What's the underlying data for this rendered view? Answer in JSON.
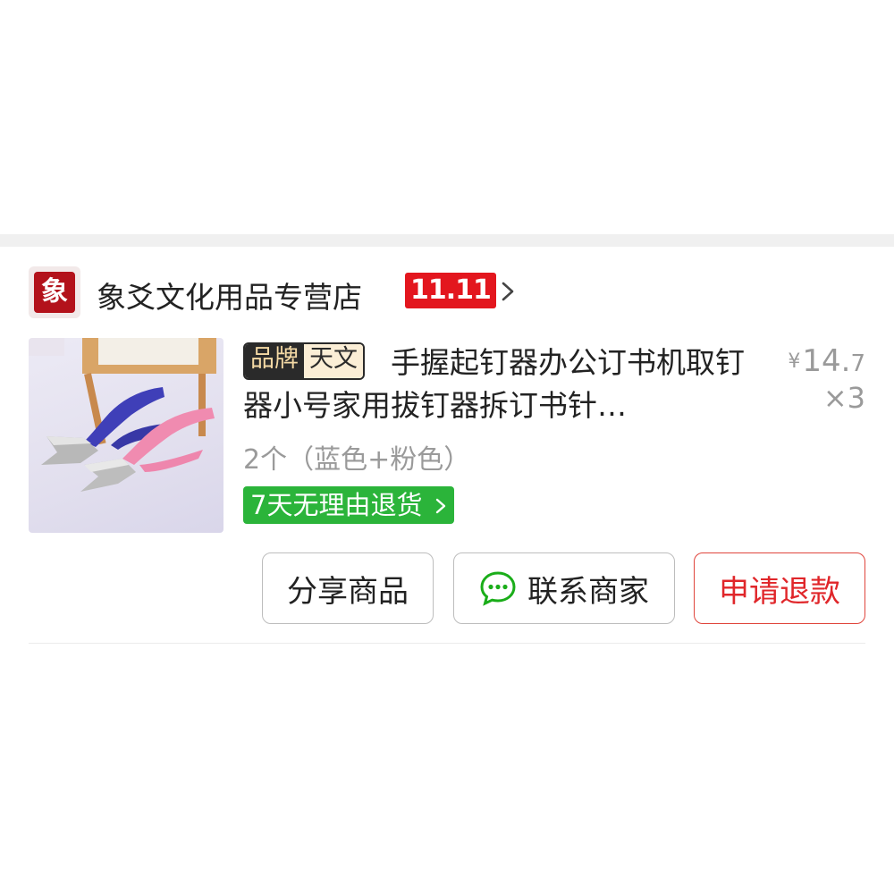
{
  "shop": {
    "name": "象爻文化用品专营店",
    "logo_text": "象",
    "promo_badge": "11.11"
  },
  "product": {
    "brand_key": "品牌",
    "brand_value": "天文",
    "title": "手握起钉器办公订书机取钉器小号家用拔钉器拆订书针…",
    "spec": "2个（蓝色+粉色）",
    "return_policy": "7天无理由退货",
    "price_currency": "¥",
    "price_int": "14.",
    "price_dec": "7",
    "quantity": "×3"
  },
  "actions": {
    "share_label": "分享商品",
    "contact_label": "联系商家",
    "refund_label": "申请退款"
  },
  "colors": {
    "promo_red": "#e3161e",
    "return_green": "#2bb43a",
    "refund_red": "#e0262a",
    "chat_green": "#1aad19"
  },
  "icons": {
    "chevron": "chevron-right-icon",
    "chat": "chat-bubble-icon"
  }
}
